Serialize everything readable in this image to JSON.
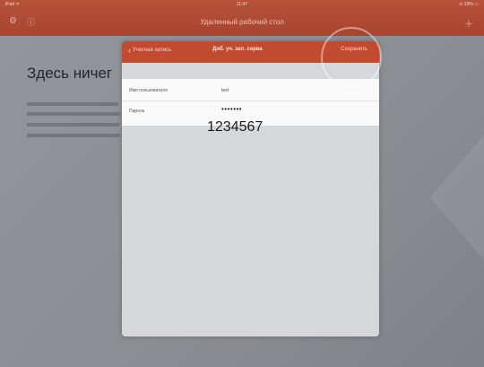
{
  "status_bar": {
    "left": "iPad ᯤ",
    "time": "11:47",
    "right": "⊙ 23% ▭"
  },
  "app_title": "Удаленный рабочий стол",
  "background": {
    "heading": "Здесь ничег"
  },
  "modal": {
    "back_label": "Учетная запись",
    "title": "Доб. уч. зап. серва",
    "save_label": "Сохранить",
    "fields": [
      {
        "label": "Имя пользователя",
        "value": "test"
      },
      {
        "label": "Пароль",
        "value": "•••••••"
      }
    ]
  },
  "annotation": "1234567",
  "colors": {
    "accent": "#c14b31",
    "topbar": "#b04a33"
  }
}
